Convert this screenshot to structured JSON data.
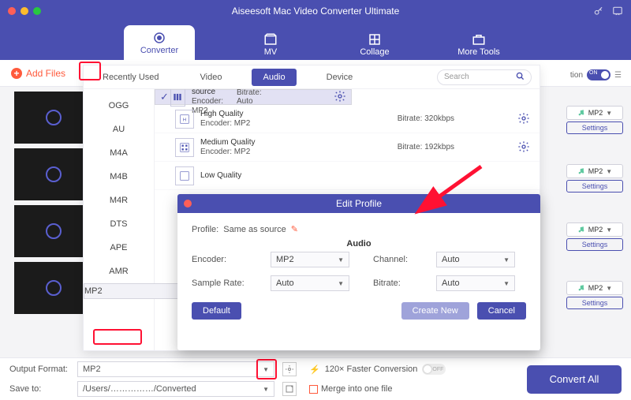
{
  "window": {
    "title": "Aiseesoft Mac Video Converter Ultimate"
  },
  "topnav": {
    "items": [
      {
        "label": "Converter"
      },
      {
        "label": "MV"
      },
      {
        "label": "Collage"
      },
      {
        "label": "More Tools"
      }
    ]
  },
  "toolbar": {
    "add": "Add Files",
    "tabs": [
      "Recently Used",
      "Video",
      "Audio",
      "Device"
    ],
    "search_ph": "Search",
    "definition": "tion",
    "definition_on": "ON"
  },
  "formats": [
    "OGG",
    "AU",
    "M4A",
    "M4B",
    "M4R",
    "DTS",
    "APE",
    "AMR",
    "MP2"
  ],
  "qualities": [
    {
      "name": "Same as source",
      "encoder": "Encoder: MP2",
      "bitrate_label": "Bitrate: Auto",
      "selected": true
    },
    {
      "name": "High Quality",
      "encoder": "Encoder: MP2",
      "bitrate_label": "Bitrate: 320kbps",
      "selected": false
    },
    {
      "name": "Medium Quality",
      "encoder": "Encoder: MP2",
      "bitrate_label": "Bitrate: 192kbps",
      "selected": false
    },
    {
      "name": "Low Quality",
      "encoder": "",
      "bitrate_label": "",
      "selected": false
    }
  ],
  "edit": {
    "title": "Edit Profile",
    "profile_label": "Profile:",
    "profile_value": "Same as source",
    "section": "Audio",
    "encoder_lab": "Encoder:",
    "encoder_val": "MP2",
    "sample_lab": "Sample Rate:",
    "sample_val": "Auto",
    "channel_lab": "Channel:",
    "channel_val": "Auto",
    "bitrate_lab": "Bitrate:",
    "bitrate_val": "Auto",
    "default": "Default",
    "create": "Create New",
    "cancel": "Cancel"
  },
  "bottom": {
    "out_label": "Output Format:",
    "out_val": "MP2",
    "save_label": "Save to:",
    "save_val": "/Users/……………/Converted",
    "faster": "120× Faster Conversion",
    "off": "OFF",
    "merge": "Merge into one file",
    "convert": "Convert All"
  },
  "side": {
    "fmt": "MP2",
    "settings": "Settings"
  }
}
